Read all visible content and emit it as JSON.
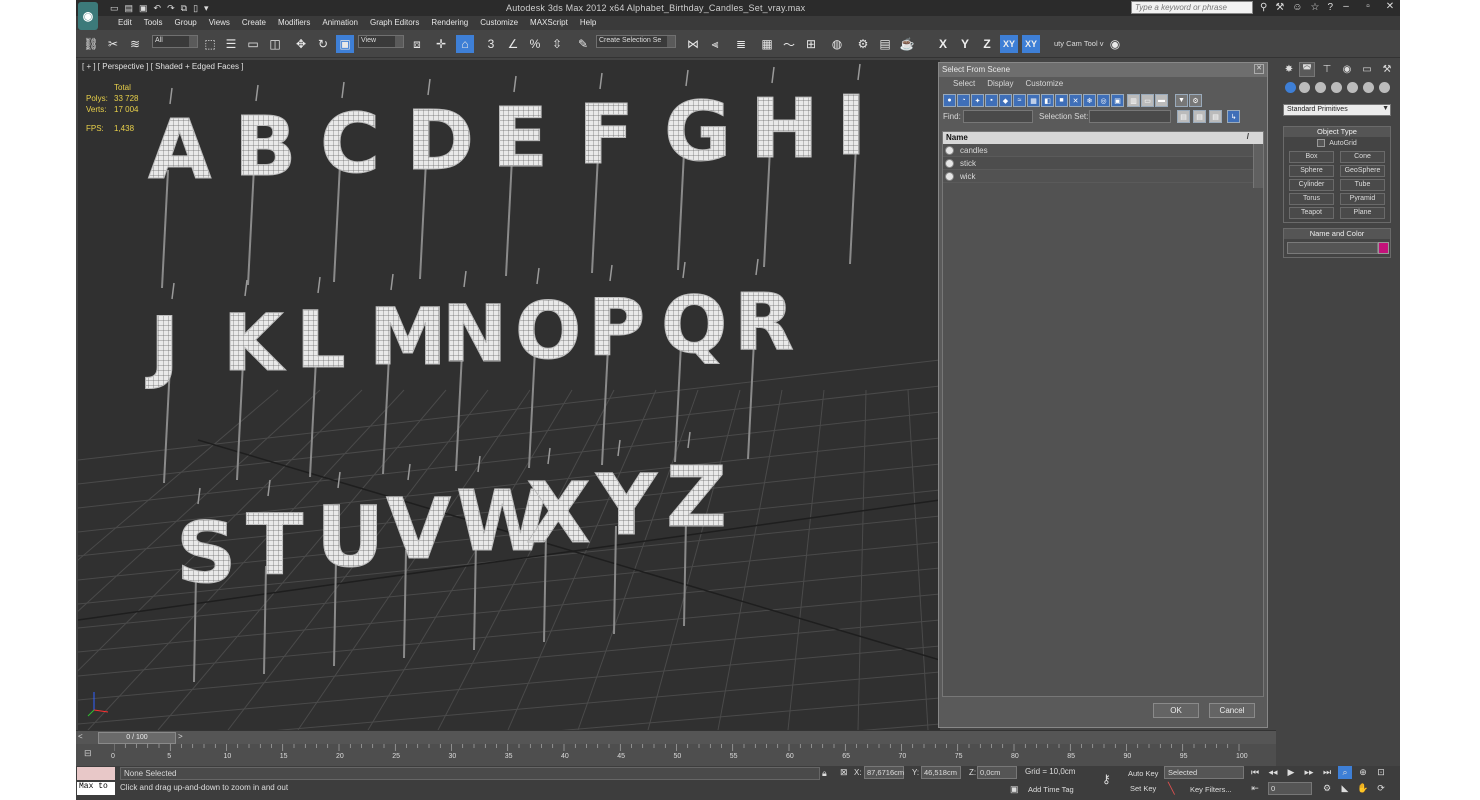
{
  "app": {
    "title": "Autodesk 3ds Max  2012 x64     Alphabet_Birthday_Candles_Set_vray.max",
    "logo": "3ds-max-logo",
    "search_placeholder": "Type a keyword or phrase"
  },
  "menu": [
    "Edit",
    "Tools",
    "Group",
    "Views",
    "Create",
    "Modifiers",
    "Animation",
    "Graph Editors",
    "Rendering",
    "Customize",
    "MAXScript",
    "Help"
  ],
  "toolbar": {
    "filter_value": "All",
    "ref_coord_value": "View",
    "selection_set_value": "Create Selection Se",
    "axes": [
      "X",
      "Y",
      "Z",
      "XY",
      "XY"
    ],
    "beauty_cam_label": "uty Cam Tool v",
    "snap_label": "3",
    "angle_label": "%"
  },
  "viewport": {
    "label": "[ + ] [ Perspective ] [ Shaded + Edged Faces ]",
    "stats": {
      "header": "Total",
      "polys_label": "Polys:",
      "polys_value": "33 728",
      "verts_label": "Verts:",
      "verts_value": "17 004",
      "fps_label": "FPS:",
      "fps_value": "1,438"
    },
    "letters": [
      "A",
      "B",
      "C",
      "D",
      "E",
      "F",
      "G",
      "H",
      "I",
      "J",
      "K",
      "L",
      "M",
      "N",
      "O",
      "P",
      "Q",
      "R",
      "S",
      "T",
      "U",
      "V",
      "W",
      "X",
      "Y",
      "Z"
    ]
  },
  "dialog": {
    "title": "Select From Scene",
    "menu": [
      "Select",
      "Display",
      "Customize"
    ],
    "find_label": "Find:",
    "selection_set_label": "Selection Set:",
    "column_name": "Name",
    "items": [
      "candles",
      "stick",
      "wick"
    ],
    "ok_label": "OK",
    "cancel_label": "Cancel"
  },
  "command_panel": {
    "category_value": "Standard Primitives",
    "object_type_header": "Object Type",
    "autogrid_label": "AutoGrid",
    "primitives": [
      "Box",
      "Cone",
      "Sphere",
      "GeoSphere",
      "Cylinder",
      "Tube",
      "Torus",
      "Pyramid",
      "Teapot",
      "Plane"
    ],
    "name_color_header": "Name and Color",
    "swatch_color": "#c3127a"
  },
  "timeline": {
    "slider_label": "0 / 100",
    "ticks": [
      "0",
      "5",
      "10",
      "15",
      "20",
      "25",
      "30",
      "35",
      "40",
      "45",
      "50",
      "55",
      "60",
      "65",
      "70",
      "75",
      "80",
      "85",
      "90",
      "95",
      "100"
    ]
  },
  "status": {
    "maxscript_label": "Max to",
    "selection_text": "None Selected",
    "prompt_text": "Click and drag up-and-down to zoom in and out",
    "x_label": "X:",
    "x_value": "87,6716cm",
    "y_label": "Y:",
    "y_value": "46,518cm",
    "z_label": "Z:",
    "z_value": "0,0cm",
    "grid_text": "Grid = 10,0cm",
    "auto_key_label": "Auto Key",
    "set_key_label": "Set Key",
    "key_mode_value": "Selected",
    "key_filters_label": "Key Filters...",
    "add_time_tag_label": "Add Time Tag",
    "frame_value": "0"
  },
  "colors": {
    "accent": "#3e7fd6",
    "viewport_bg": "#303030",
    "stats_text": "#e8d04a"
  }
}
